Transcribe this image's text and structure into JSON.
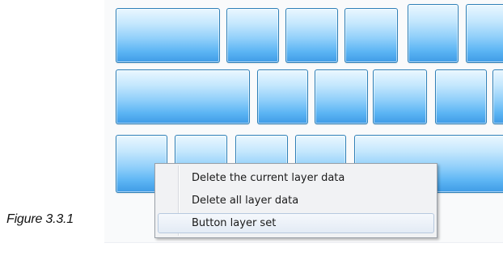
{
  "context_menu": {
    "items": [
      {
        "label": "Delete the current layer data"
      },
      {
        "label": "Delete all layer data"
      },
      {
        "label": "Button layer set",
        "hovered": true
      }
    ]
  },
  "caption": "Figure 3.3.1",
  "colors": {
    "key_gradient_top": "#eaf7ff",
    "key_gradient_bottom": "#3f9be6",
    "key_border": "#2e80b8",
    "menu_background": "#f1f2f4",
    "menu_hover": "#e3ebf5"
  }
}
